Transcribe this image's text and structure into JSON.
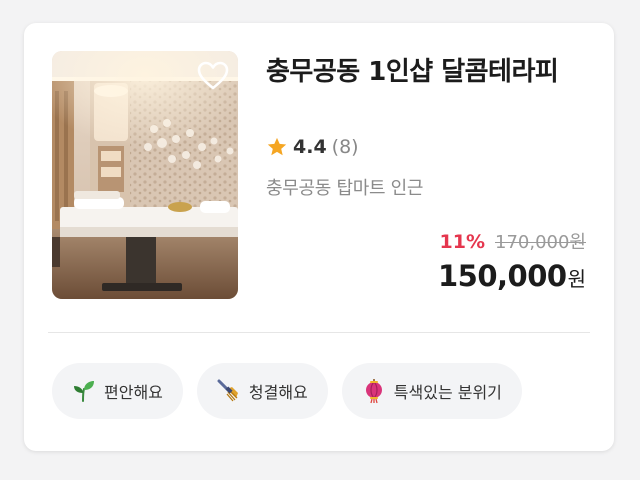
{
  "listing": {
    "title": "충무공동 1인샵 달콤테라피",
    "rating": "4.4",
    "review_count": "(8)",
    "location": "충무공동 탑마트 인근",
    "discount": "11%",
    "original_price": "170,000원",
    "price": "150,000",
    "price_unit": "원",
    "favorited": false
  },
  "tags": [
    {
      "label": "편안해요",
      "icon": "sprout-icon"
    },
    {
      "label": "청결해요",
      "icon": "broom-icon"
    },
    {
      "label": "특색있는 분위기",
      "icon": "lantern-icon"
    }
  ],
  "colors": {
    "discount": "#e5364e",
    "star": "#f5a623",
    "muted": "#8b8b8b",
    "tag_bg": "#f3f4f6"
  }
}
